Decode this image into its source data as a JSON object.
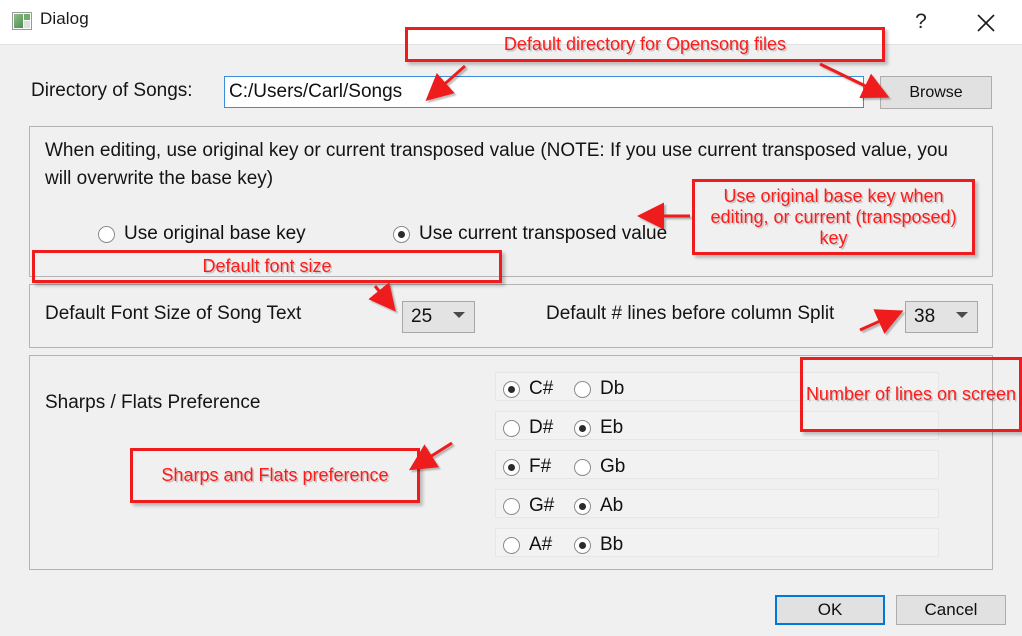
{
  "window": {
    "title": "Dialog",
    "icon": "app-window-icon",
    "help_glyph": "?",
    "close_glyph": "✕"
  },
  "directory": {
    "label": "Directory of Songs:",
    "value": "C:/Users/Carl/Songs",
    "placeholder": "",
    "browse_label": "Browse"
  },
  "editing_group": {
    "note": "When editing, use original key or current transposed value  (NOTE: If you use current transposed value, you will overwrite the base key)",
    "options": [
      {
        "label": "Use original base key",
        "selected": false
      },
      {
        "label": "Use current transposed value",
        "selected": true
      }
    ]
  },
  "font_group": {
    "font_size_label": "Default Font Size of Song Text",
    "font_size_value": "25",
    "split_label": "Default # lines before column Split",
    "split_value": "38"
  },
  "sharps_group": {
    "title": "Sharps / Flats Preference",
    "rows": [
      {
        "sharp": "C#",
        "sharp_selected": true,
        "flat": "Db",
        "flat_selected": false
      },
      {
        "sharp": "D#",
        "sharp_selected": false,
        "flat": "Eb",
        "flat_selected": true
      },
      {
        "sharp": "F#",
        "sharp_selected": true,
        "flat": "Gb",
        "flat_selected": false
      },
      {
        "sharp": "G#",
        "sharp_selected": false,
        "flat": "Ab",
        "flat_selected": true
      },
      {
        "sharp": "A#",
        "sharp_selected": false,
        "flat": "Bb",
        "flat_selected": true
      }
    ]
  },
  "buttons": {
    "ok": "OK",
    "cancel": "Cancel"
  },
  "annotations": {
    "directory": "Default directory for Opensong files",
    "key": "Use original base key when editing, or current (transposed) key",
    "font_size": "Default font size",
    "lines": "Number of lines on screen",
    "sharps": "Sharps and Flats preference",
    "color": "#ff1a1a"
  },
  "colors": {
    "accent": "#0078d7",
    "dialog_bg": "#f0f0f0",
    "titlebar_bg": "#ffffff",
    "field_border": "#3c8ddb",
    "annotation_red": "#ee1c1c"
  }
}
